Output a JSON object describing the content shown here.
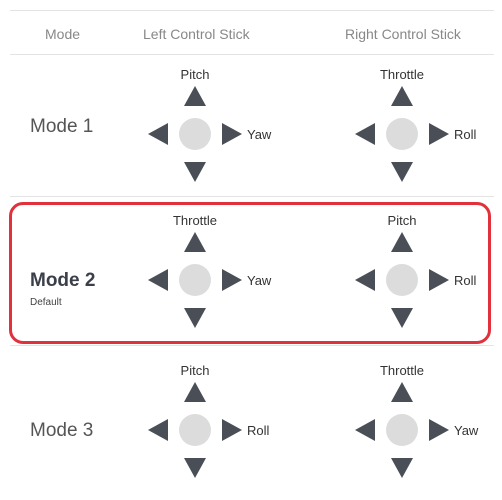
{
  "headers": {
    "mode": "Mode",
    "left": "Left Control Stick",
    "right": "Right Control Stick"
  },
  "modes": [
    {
      "name": "Mode 1",
      "sub": "",
      "left": {
        "up": "Pitch",
        "side": "Yaw"
      },
      "right": {
        "up": "Throttle",
        "side": "Roll"
      }
    },
    {
      "name": "Mode 2",
      "sub": "Default",
      "left": {
        "up": "Throttle",
        "side": "Yaw"
      },
      "right": {
        "up": "Pitch",
        "side": "Roll"
      }
    },
    {
      "name": "Mode 3",
      "sub": "",
      "left": {
        "up": "Pitch",
        "side": "Roll"
      },
      "right": {
        "up": "Throttle",
        "side": "Yaw"
      }
    }
  ],
  "colors": {
    "selected_border": "#e0313c",
    "arrow": "#4a4f57",
    "knob": "#dcdcdc"
  },
  "icons": {
    "arrows": [
      "triangle-up-icon",
      "triangle-down-icon",
      "triangle-left-icon",
      "triangle-right-icon"
    ],
    "knob": "stick-knob-icon"
  }
}
